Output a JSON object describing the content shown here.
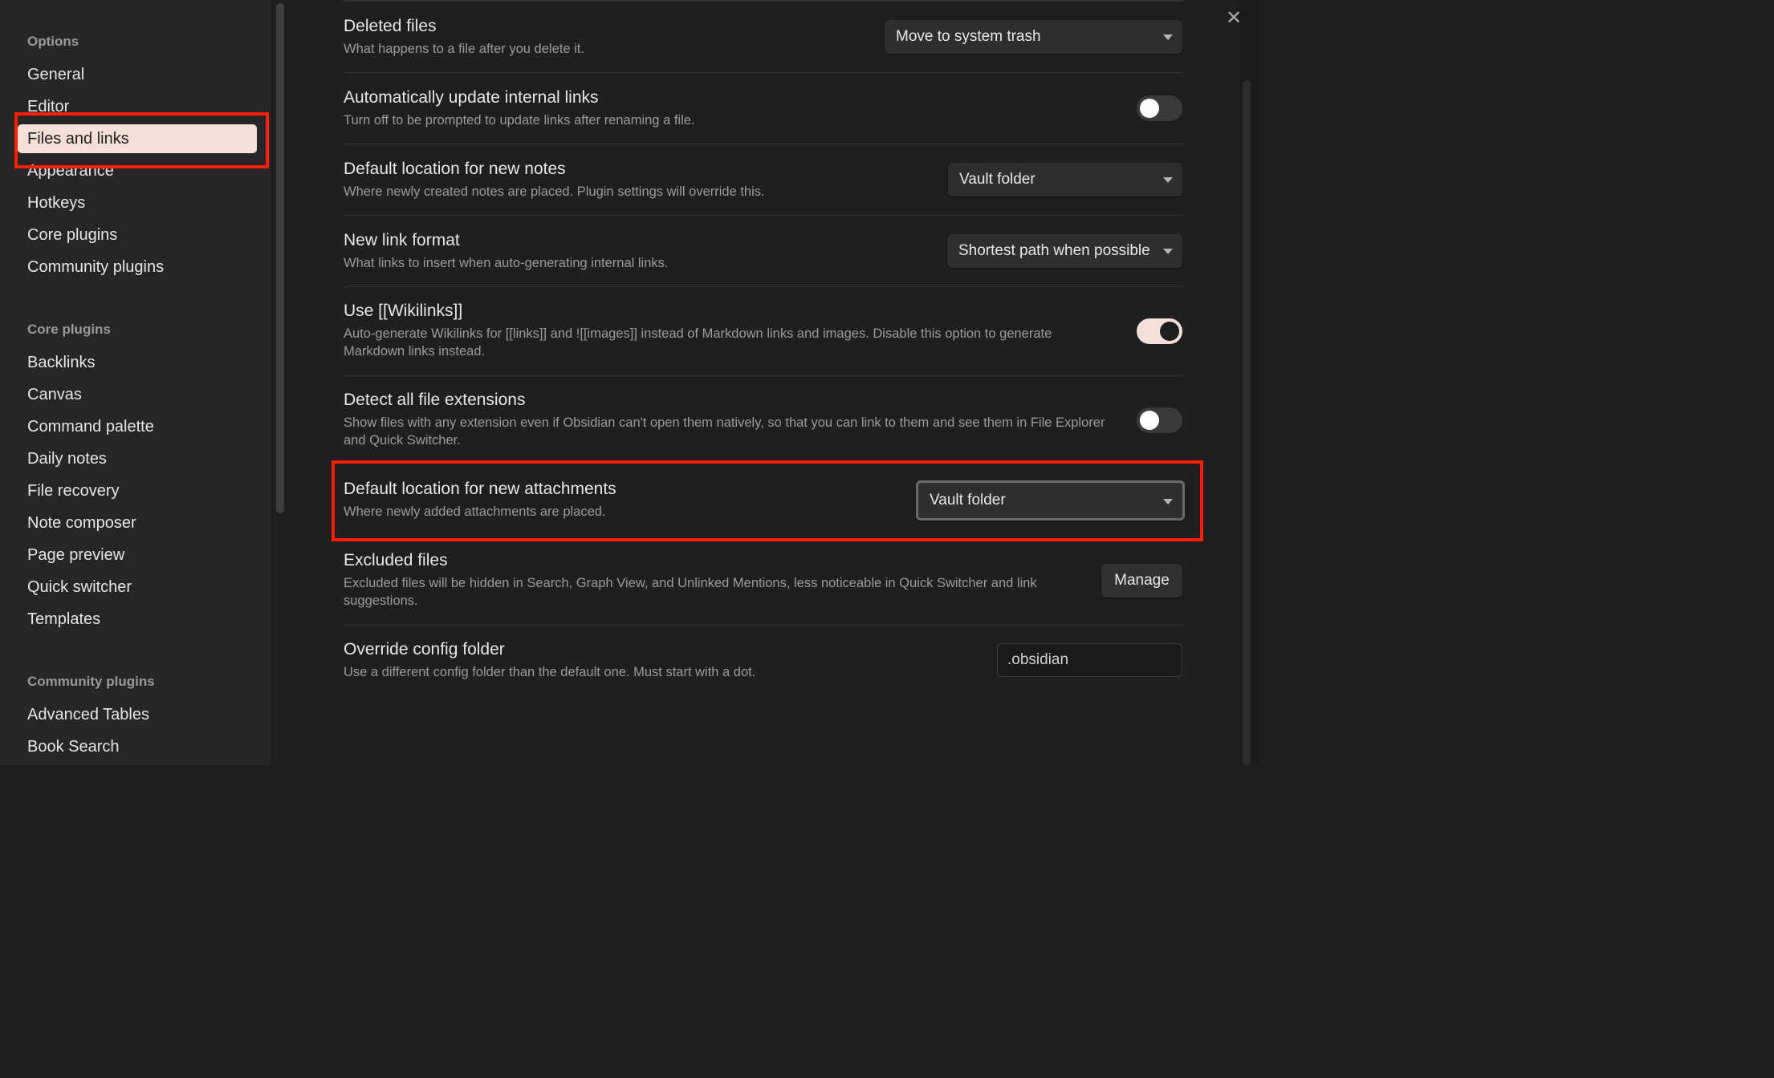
{
  "sidebar": {
    "options_header": "Options",
    "options": [
      {
        "label": "General"
      },
      {
        "label": "Editor"
      },
      {
        "label": "Files and links"
      },
      {
        "label": "Appearance"
      },
      {
        "label": "Hotkeys"
      },
      {
        "label": "Core plugins"
      },
      {
        "label": "Community plugins"
      }
    ],
    "core_header": "Core plugins",
    "core": [
      {
        "label": "Backlinks"
      },
      {
        "label": "Canvas"
      },
      {
        "label": "Command palette"
      },
      {
        "label": "Daily notes"
      },
      {
        "label": "File recovery"
      },
      {
        "label": "Note composer"
      },
      {
        "label": "Page preview"
      },
      {
        "label": "Quick switcher"
      },
      {
        "label": "Templates"
      }
    ],
    "community_header": "Community plugins",
    "community": [
      {
        "label": "Advanced Tables"
      },
      {
        "label": "Book Search"
      }
    ]
  },
  "close_glyph": "✕",
  "settings": {
    "deleted": {
      "title": "Deleted files",
      "desc": "What happens to a file after you delete it.",
      "value": "Move to system trash"
    },
    "autoupdate": {
      "title": "Automatically update internal links",
      "desc": "Turn off to be prompted to update links after renaming a file.",
      "enabled": false
    },
    "newnotes": {
      "title": "Default location for new notes",
      "desc": "Where newly created notes are placed. Plugin settings will override this.",
      "value": "Vault folder"
    },
    "linkformat": {
      "title": "New link format",
      "desc": "What links to insert when auto-generating internal links.",
      "value": "Shortest path when possible"
    },
    "wikilinks": {
      "title": "Use [[Wikilinks]]",
      "desc": "Auto-generate Wikilinks for [[links]] and ![[images]] instead of Markdown links and images. Disable this option to generate Markdown links instead.",
      "enabled": true
    },
    "detectext": {
      "title": "Detect all file extensions",
      "desc": "Show files with any extension even if Obsidian can't open them natively, so that you can link to them and see them in File Explorer and Quick Switcher.",
      "enabled": false
    },
    "attachments": {
      "title": "Default location for new attachments",
      "desc": "Where newly added attachments are placed.",
      "value": "Vault folder"
    },
    "excluded": {
      "title": "Excluded files",
      "desc": "Excluded files will be hidden in Search, Graph View, and Unlinked Mentions, less noticeable in Quick Switcher and link suggestions.",
      "button": "Manage"
    },
    "configfolder": {
      "title": "Override config folder",
      "desc": "Use a different config folder than the default one. Must start with a dot.",
      "value": ".obsidian"
    }
  },
  "colors": {
    "highlight": "#ff1e00",
    "active_item_bg": "#f5e0d8"
  }
}
